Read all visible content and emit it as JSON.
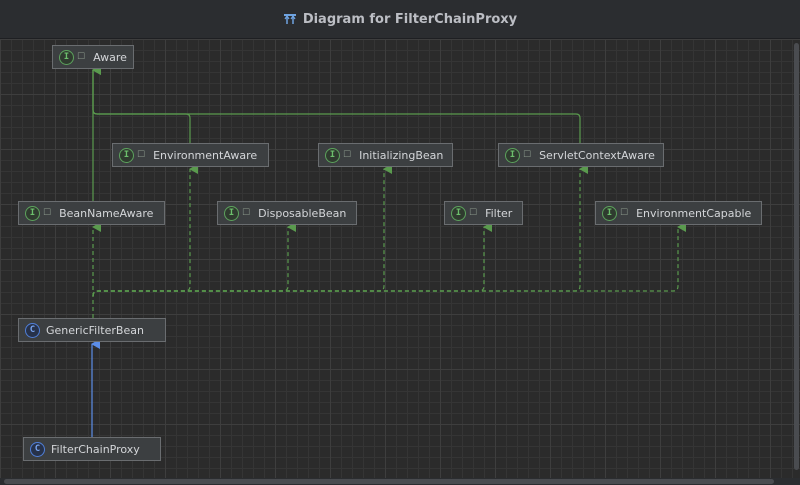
{
  "window": {
    "title": "Diagram for FilterChainProxy",
    "title_icon": "uml-diagram-icon"
  },
  "legend": {
    "interface_marker": "I",
    "class_marker": "C",
    "visibility_icon": "public-visibility-icon"
  },
  "nodes": [
    {
      "id": "aware",
      "label": "Aware",
      "kind": "interface"
    },
    {
      "id": "environment-aware",
      "label": "EnvironmentAware",
      "kind": "interface"
    },
    {
      "id": "initializing-bean",
      "label": "InitializingBean",
      "kind": "interface"
    },
    {
      "id": "servlet-context-aware",
      "label": "ServletContextAware",
      "kind": "interface"
    },
    {
      "id": "bean-name-aware",
      "label": "BeanNameAware",
      "kind": "interface"
    },
    {
      "id": "disposable-bean",
      "label": "DisposableBean",
      "kind": "interface"
    },
    {
      "id": "filter",
      "label": "Filter",
      "kind": "interface"
    },
    {
      "id": "environment-capable",
      "label": "EnvironmentCapable",
      "kind": "interface"
    },
    {
      "id": "generic-filter-bean",
      "label": "GenericFilterBean",
      "kind": "class"
    },
    {
      "id": "filter-chain-proxy",
      "label": "FilterChainProxy",
      "kind": "class"
    }
  ],
  "edges": [
    {
      "from": "environment-aware",
      "to": "aware",
      "type": "extends-interface"
    },
    {
      "from": "servlet-context-aware",
      "to": "aware",
      "type": "extends-interface"
    },
    {
      "from": "bean-name-aware",
      "to": "aware",
      "type": "extends-interface"
    },
    {
      "from": "generic-filter-bean",
      "to": "bean-name-aware",
      "type": "implements"
    },
    {
      "from": "generic-filter-bean",
      "to": "environment-aware",
      "type": "implements"
    },
    {
      "from": "generic-filter-bean",
      "to": "initializing-bean",
      "type": "implements"
    },
    {
      "from": "generic-filter-bean",
      "to": "servlet-context-aware",
      "type": "implements"
    },
    {
      "from": "generic-filter-bean",
      "to": "disposable-bean",
      "type": "implements"
    },
    {
      "from": "generic-filter-bean",
      "to": "filter",
      "type": "implements"
    },
    {
      "from": "generic-filter-bean",
      "to": "environment-capable",
      "type": "implements"
    },
    {
      "from": "filter-chain-proxy",
      "to": "generic-filter-bean",
      "type": "extends-class"
    }
  ],
  "colors": {
    "interface_edge": "#5a9a4e",
    "class_edge": "#5b8de8",
    "background": "#2b2b2b"
  }
}
